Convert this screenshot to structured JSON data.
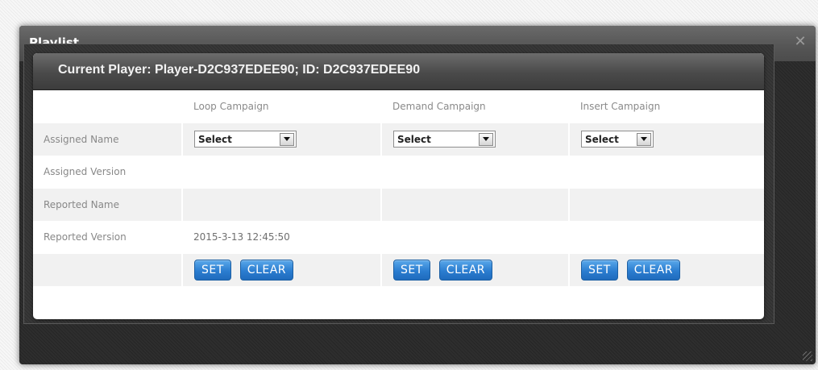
{
  "dialog": {
    "title": "Playlist",
    "close_icon": "close-icon"
  },
  "panel": {
    "title": "Current Player: Player-D2C937EDEE90;  ID: D2C937EDEE90"
  },
  "columns": {
    "loop": "Loop Campaign",
    "demand": "Demand Campaign",
    "insert": "Insert Campaign"
  },
  "rows": {
    "assigned_name": "Assigned Name",
    "assigned_version": "Assigned Version",
    "reported_name": "Reported Name",
    "reported_version": "Reported Version"
  },
  "selects": {
    "loop": "Select",
    "demand": "Select",
    "insert": "Select"
  },
  "values": {
    "loop_reported_version": "2015-3-13 12:45:50"
  },
  "buttons": {
    "set": "SET",
    "clear": "CLEAR"
  },
  "colors": {
    "button_blue": "#2b7dd0",
    "header_dark": "#4a4a4a"
  }
}
